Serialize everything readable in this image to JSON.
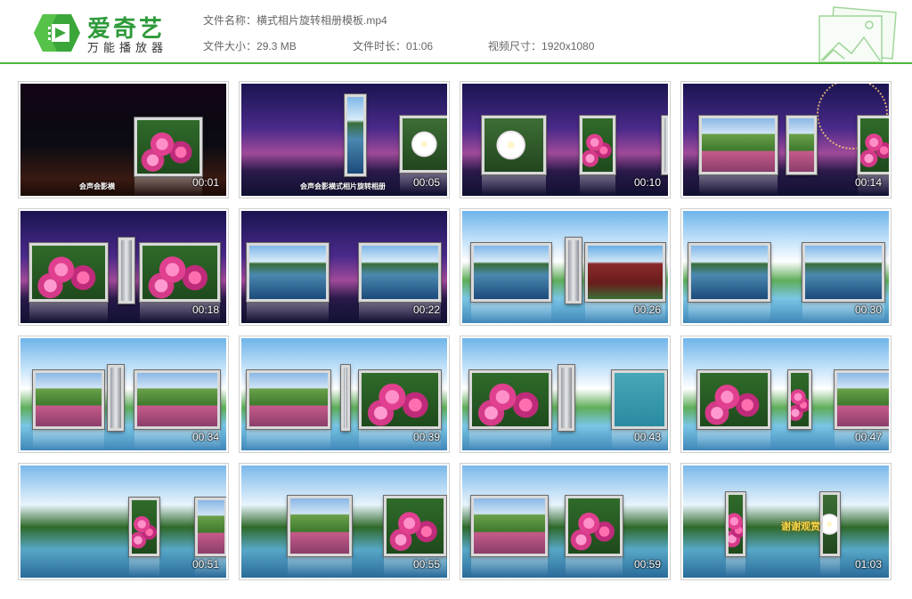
{
  "brand": {
    "name": "爱奇艺",
    "subtitle": "万能播放器",
    "accent": "#4bb83a"
  },
  "file_info": {
    "name_label": "文件名称：",
    "name_value": "横式相片旋转相册模板.mp4",
    "size_label": "文件大小：",
    "size_value": "29.3 MB",
    "duration_label": "文件时长：",
    "duration_value": "01:06",
    "resolution_label": "视频尺寸：",
    "resolution_value": "1920x1080"
  },
  "thumbnails": [
    {
      "time": "00:01",
      "caption": "会声会影横",
      "title_art": ""
    },
    {
      "time": "00:05",
      "caption": "会声会影横式相片旋转相册",
      "title_art": ""
    },
    {
      "time": "00:10",
      "caption": "",
      "title_art": ""
    },
    {
      "time": "00:14",
      "caption": "",
      "title_art": ""
    },
    {
      "time": "00:18",
      "caption": "",
      "title_art": ""
    },
    {
      "time": "00:22",
      "caption": "",
      "title_art": ""
    },
    {
      "time": "00:26",
      "caption": "",
      "title_art": ""
    },
    {
      "time": "00:30",
      "caption": "",
      "title_art": ""
    },
    {
      "time": "00:34",
      "caption": "",
      "title_art": ""
    },
    {
      "time": "00:39",
      "caption": "",
      "title_art": ""
    },
    {
      "time": "00:43",
      "caption": "",
      "title_art": ""
    },
    {
      "time": "00:47",
      "caption": "",
      "title_art": ""
    },
    {
      "time": "00:51",
      "caption": "",
      "title_art": ""
    },
    {
      "time": "00:55",
      "caption": "",
      "title_art": ""
    },
    {
      "time": "00:59",
      "caption": "",
      "title_art": ""
    },
    {
      "time": "01:03",
      "caption": "",
      "title_art": "谢谢观赏"
    }
  ]
}
